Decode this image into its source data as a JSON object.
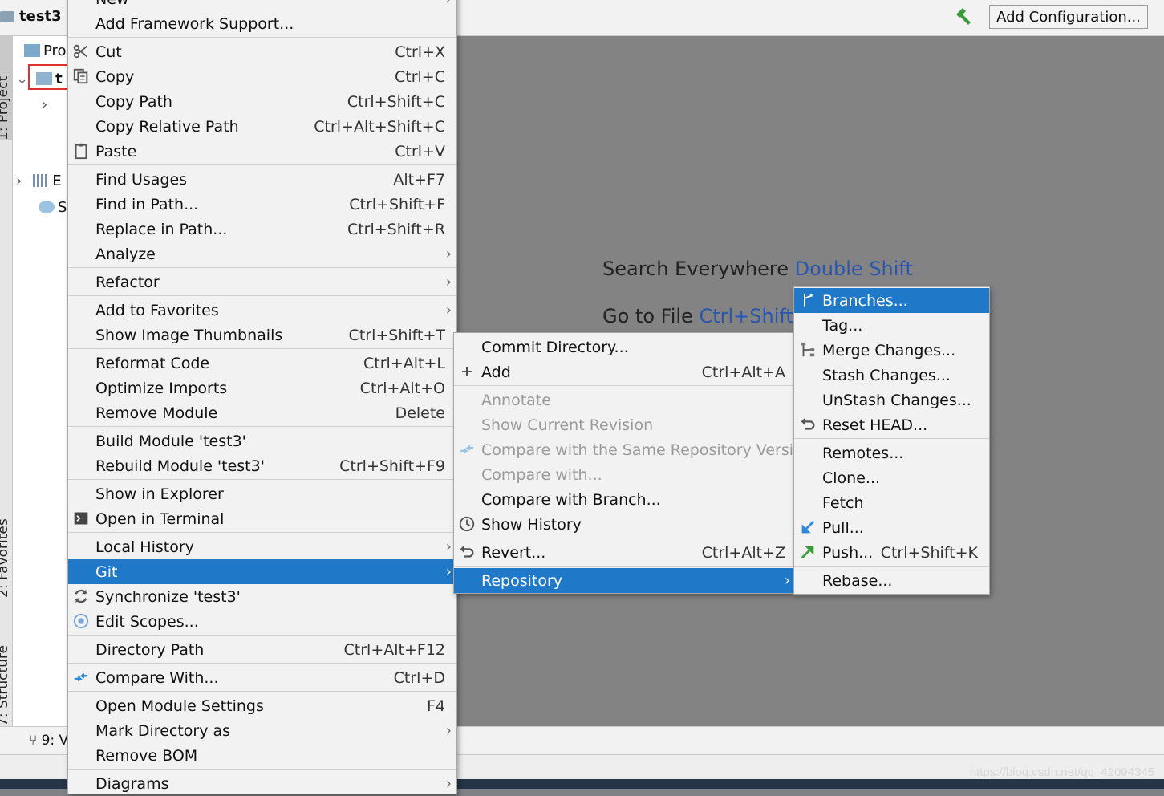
{
  "topbar": {
    "project_name": "test3",
    "add_configuration_label": "Add Configuration..."
  },
  "left_strip": {
    "tab_project": "1: Project",
    "tab_favorites": "2: Favorites",
    "tab_structure": "7: Structure"
  },
  "tree": {
    "row1": "Pro",
    "row2": "t",
    "row3": "E",
    "row4": "S"
  },
  "editor": {
    "search_everywhere_label": "Search Everywhere",
    "search_everywhere_key": "Double Shift",
    "go_to_file_label": "Go to File",
    "go_to_file_key": "Ctrl+Shift+"
  },
  "bottom_bar": {
    "version_control_tool": "9: V"
  },
  "watermark": "https://blog.csdn.net/qq_42094345",
  "main_menu": [
    {
      "label": "New",
      "arrow": true
    },
    {
      "label": "Add Framework Support..."
    },
    {
      "label": "Cut",
      "shortcut": "Ctrl+X",
      "icon": "scissors-icon"
    },
    {
      "label": "Copy",
      "shortcut": "Ctrl+C",
      "icon": "copy-icon"
    },
    {
      "label": "Copy Path",
      "shortcut": "Ctrl+Shift+C"
    },
    {
      "label": "Copy Relative Path",
      "shortcut": "Ctrl+Alt+Shift+C"
    },
    {
      "label": "Paste",
      "shortcut": "Ctrl+V",
      "icon": "clipboard-icon"
    },
    {
      "label": "Find Usages",
      "shortcut": "Alt+F7"
    },
    {
      "label": "Find in Path...",
      "shortcut": "Ctrl+Shift+F"
    },
    {
      "label": "Replace in Path...",
      "shortcut": "Ctrl+Shift+R"
    },
    {
      "label": "Analyze",
      "arrow": true
    },
    {
      "label": "Refactor",
      "arrow": true
    },
    {
      "label": "Add to Favorites",
      "arrow": true
    },
    {
      "label": "Show Image Thumbnails",
      "shortcut": "Ctrl+Shift+T"
    },
    {
      "label": "Reformat Code",
      "shortcut": "Ctrl+Alt+L"
    },
    {
      "label": "Optimize Imports",
      "shortcut": "Ctrl+Alt+O"
    },
    {
      "label": "Remove Module",
      "shortcut": "Delete"
    },
    {
      "label": "Build Module 'test3'"
    },
    {
      "label": "Rebuild Module 'test3'",
      "shortcut": "Ctrl+Shift+F9"
    },
    {
      "label": "Show in Explorer"
    },
    {
      "label": "Open in Terminal",
      "icon": "terminal-icon"
    },
    {
      "label": "Local History",
      "arrow": true
    },
    {
      "label": "Git",
      "arrow": true,
      "highlighted": true
    },
    {
      "label": "Synchronize 'test3'",
      "icon": "sync-icon"
    },
    {
      "label": "Edit Scopes...",
      "icon": "scope-icon"
    },
    {
      "label": "Directory Path",
      "shortcut": "Ctrl+Alt+F12"
    },
    {
      "label": "Compare With...",
      "shortcut": "Ctrl+D",
      "icon": "compare-icon"
    },
    {
      "label": "Open Module Settings",
      "shortcut": "F4"
    },
    {
      "label": "Mark Directory as",
      "arrow": true
    },
    {
      "label": "Remove BOM"
    },
    {
      "label": "Diagrams",
      "arrow": true
    }
  ],
  "git_menu": [
    {
      "label": "Commit Directory..."
    },
    {
      "label": "Add",
      "shortcut": "Ctrl+Alt+A",
      "icon": "plus-icon"
    },
    {
      "label": "Annotate",
      "disabled": true
    },
    {
      "label": "Show Current Revision",
      "disabled": true
    },
    {
      "label": "Compare with the Same Repository Version",
      "disabled": true,
      "icon": "compare-icon"
    },
    {
      "label": "Compare with...",
      "disabled": true
    },
    {
      "label": "Compare with Branch..."
    },
    {
      "label": "Show History",
      "icon": "clock-icon"
    },
    {
      "label": "Revert...",
      "shortcut": "Ctrl+Alt+Z",
      "icon": "revert-icon"
    },
    {
      "label": "Repository",
      "arrow": true,
      "highlighted": true
    }
  ],
  "repo_menu": [
    {
      "label": "Branches...",
      "highlighted": true,
      "icon": "branch-icon"
    },
    {
      "label": "Tag..."
    },
    {
      "label": "Merge Changes...",
      "icon": "merge-icon"
    },
    {
      "label": "Stash Changes..."
    },
    {
      "label": "UnStash Changes..."
    },
    {
      "label": "Reset HEAD...",
      "icon": "reset-icon"
    },
    {
      "label": "Remotes..."
    },
    {
      "label": "Clone..."
    },
    {
      "label": "Fetch"
    },
    {
      "label": "Pull...",
      "icon": "pull-arrow-icon"
    },
    {
      "label": "Push...",
      "shortcut": "Ctrl+Shift+K",
      "icon": "push-arrow-icon"
    },
    {
      "label": "Rebase..."
    }
  ],
  "colors": {
    "highlight": "#1f79c8",
    "shortcut_key_blue": "#2a56b0",
    "hammer_green": "#3c9a3c"
  }
}
